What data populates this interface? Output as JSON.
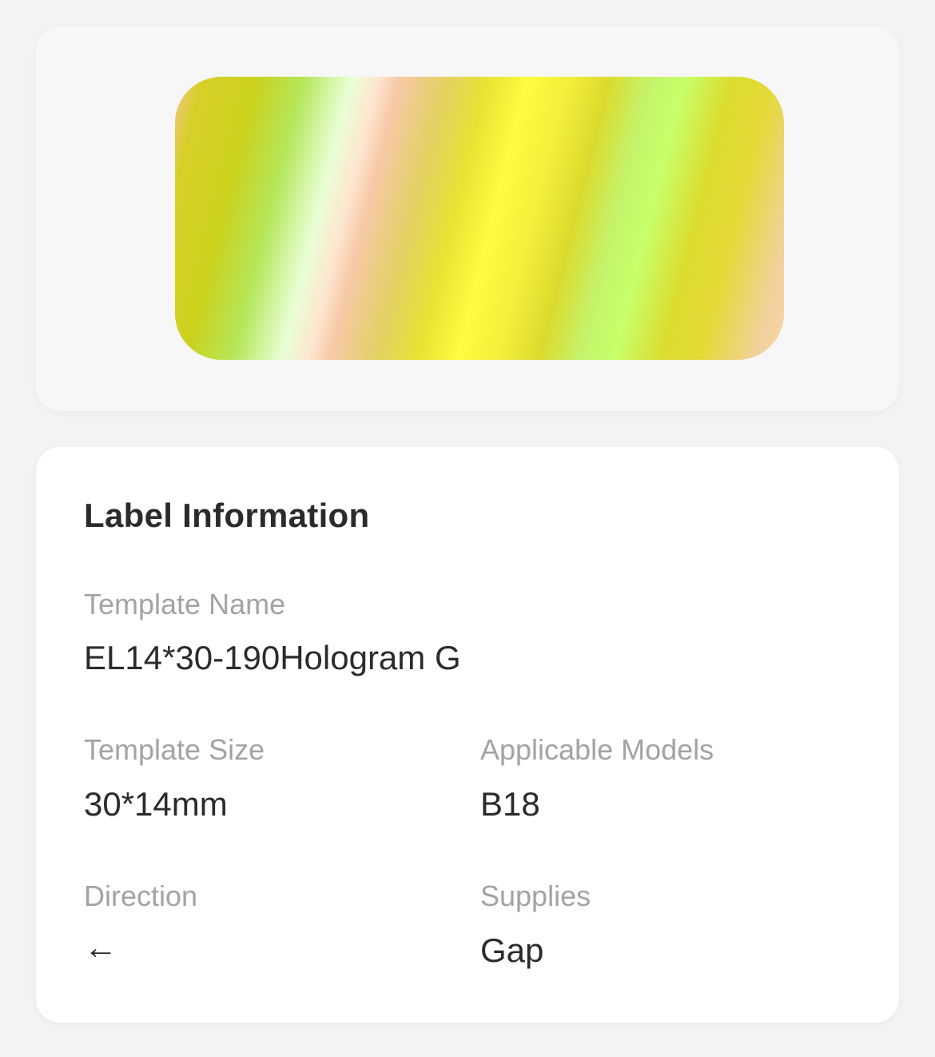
{
  "preview": {
    "label_name": "EL14*30-190Hologram G"
  },
  "info": {
    "title": "Label Information",
    "fields": {
      "template_name": {
        "label": "Template Name",
        "value": "EL14*30-190Hologram G"
      },
      "template_size": {
        "label": "Template Size",
        "value": "30*14mm"
      },
      "applicable_models": {
        "label": "Applicable Models",
        "value": "B18"
      },
      "direction": {
        "label": "Direction",
        "value": "←",
        "icon": "arrow-left-icon"
      },
      "supplies": {
        "label": "Supplies",
        "value": "Gap"
      }
    }
  },
  "colors": {
    "page_background": "#f3f3f3",
    "card_background": "#ffffff",
    "label_text": "#a3a3a3",
    "value_text": "#2b2b2b"
  }
}
